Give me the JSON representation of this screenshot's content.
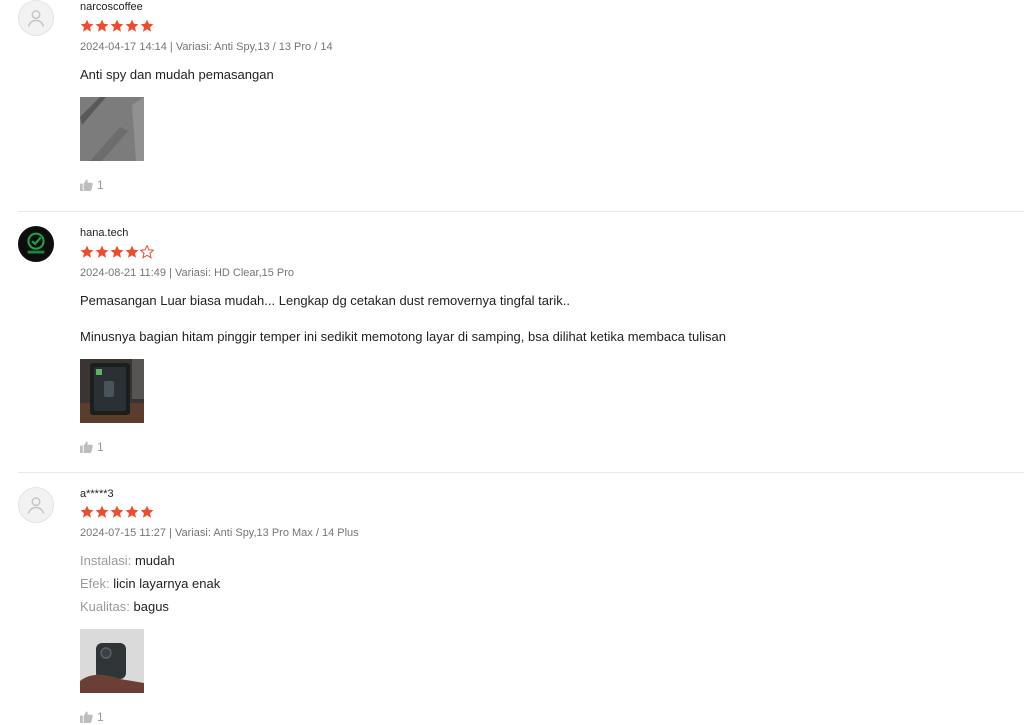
{
  "reviews": [
    {
      "username": "narcoscoffee",
      "rating": 5,
      "date": "2024-04-17 14:14",
      "separator": "|",
      "variation": "Variasi: Anti Spy,13 / 13 Pro / 14",
      "text": "Anti spy dan mudah pemasangan",
      "likes": "1"
    },
    {
      "username": "hana.tech",
      "rating": 4,
      "date": "2024-08-21 11:49",
      "separator": "|",
      "variation": "Variasi: HD Clear,15 Pro",
      "text": "Pemasangan Luar biasa mudah... Lengkap dg cetakan dust removernya tingfal tarik..",
      "text2": "Minusnya bagian hitam pinggir temper ini sedikit memotong layar di samping, bsa dilihat ketika membaca tulisan",
      "likes": "1"
    },
    {
      "username": "a*****3",
      "rating": 5,
      "date": "2024-07-15 11:27",
      "separator": "|",
      "variation": "Variasi: Anti Spy,13 Pro Max / 14 Plus",
      "attributes": [
        {
          "label": "Instalasi:",
          "value": "mudah"
        },
        {
          "label": "Efek:",
          "value": "licin layarnya enak"
        },
        {
          "label": "Kualitas:",
          "value": "bagus"
        }
      ],
      "likes": "1"
    }
  ],
  "colors": {
    "star": "#ee4d2d",
    "meta": "#757575",
    "divider": "#e8e8e8"
  },
  "icons": {
    "avatar": "user-icon",
    "like": "thumbs-up-icon",
    "star": "star-icon"
  }
}
